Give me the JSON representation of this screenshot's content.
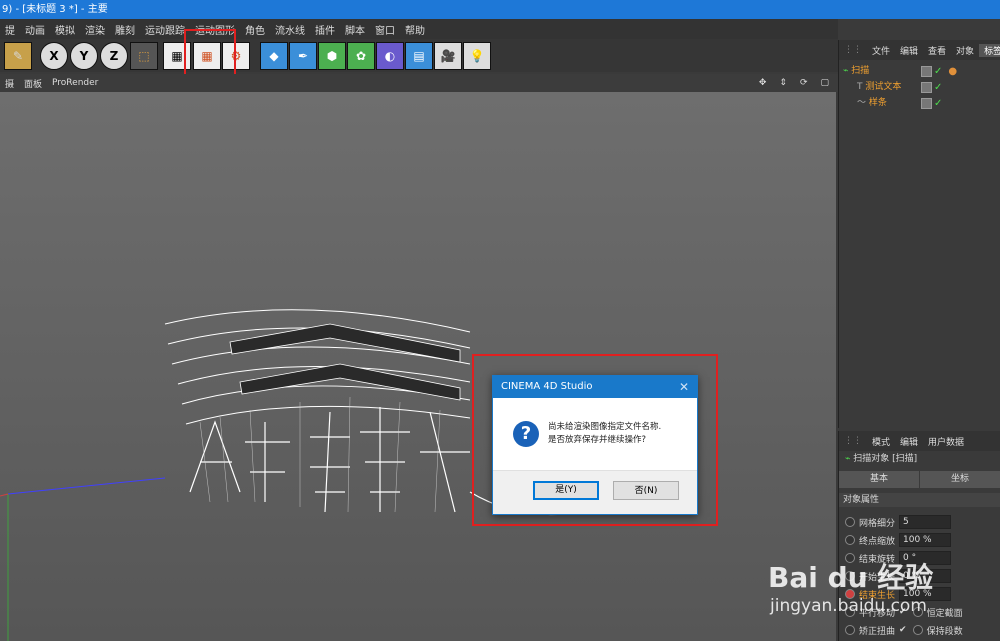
{
  "window": {
    "title": "9) - [未标题 3 *] - 主要"
  },
  "menu": [
    "提",
    "动画",
    "模拟",
    "渲染",
    "雕刻",
    "运动跟踪",
    "运动图形",
    "角色",
    "流水线",
    "插件",
    "脚本",
    "窗口",
    "帮助"
  ],
  "toolbar": {
    "x_label": "X",
    "y_label": "Y",
    "z_label": "Z"
  },
  "viewport_menu": [
    "摄",
    "面板",
    "ProRender"
  ],
  "object_manager": {
    "tabs": [
      "文件",
      "编辑",
      "查看",
      "对象",
      "标签"
    ],
    "objects": [
      {
        "name": "扫描",
        "icon": "sweep-icon"
      },
      {
        "name": "测试文本",
        "icon": "text-icon"
      },
      {
        "name": "样条",
        "icon": "spline-icon"
      }
    ]
  },
  "attributes": {
    "tabs": [
      "模式",
      "编辑",
      "用户数据"
    ],
    "object_title": "扫描对象 [扫描]",
    "sub_tabs": [
      "基本",
      "坐标"
    ],
    "section": "对象属性",
    "props": [
      {
        "label": "网格细分",
        "value": "5"
      },
      {
        "label": "终点缩放",
        "value": "100 %"
      },
      {
        "label": "结束旋转",
        "value": "0 °"
      },
      {
        "label": "开始生长",
        "value": "0 %"
      },
      {
        "label": "结束生长",
        "value": "100 %"
      }
    ],
    "checks": [
      {
        "label": "平行移动",
        "checked": true
      },
      {
        "label": "恒定截面",
        "checked": true
      },
      {
        "label": "矫正扭曲",
        "checked": true
      },
      {
        "label": "保持段数",
        "checked": true
      }
    ]
  },
  "dialog": {
    "title": "CINEMA 4D Studio",
    "message_line1": "尚未给渲染图像指定文件名称.",
    "message_line2": "是否放弃保存并继续操作?",
    "yes_label": "是(Y)",
    "no_label": "否(N)",
    "icon": "question-icon"
  },
  "watermark": {
    "brand": "Bai du 经验",
    "url": "jingyan.baidu.com"
  }
}
